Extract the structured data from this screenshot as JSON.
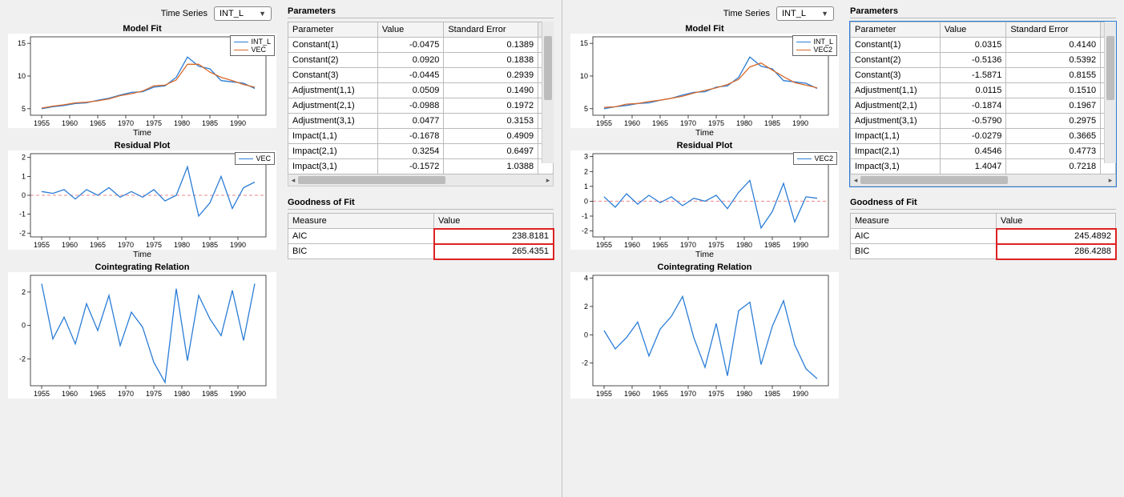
{
  "panels": [
    {
      "time_series_label": "Time Series",
      "time_series_value": "INT_L",
      "parameters_label": "Parameters",
      "param_headers": [
        "Parameter",
        "Value",
        "Standard Error"
      ],
      "param_rows": [
        {
          "p": "Constant(1)",
          "v": "-0.0475",
          "se": "0.1389"
        },
        {
          "p": "Constant(2)",
          "v": "0.0920",
          "se": "0.1838"
        },
        {
          "p": "Constant(3)",
          "v": "-0.0445",
          "se": "0.2939"
        },
        {
          "p": "Adjustment(1,1)",
          "v": "0.0509",
          "se": "0.1490"
        },
        {
          "p": "Adjustment(2,1)",
          "v": "-0.0988",
          "se": "0.1972"
        },
        {
          "p": "Adjustment(3,1)",
          "v": "0.0477",
          "se": "0.3153"
        },
        {
          "p": "Impact(1,1)",
          "v": "-0.1678",
          "se": "0.4909"
        },
        {
          "p": "Impact(2,1)",
          "v": "0.3254",
          "se": "0.6497"
        },
        {
          "p": "Impact(3,1)",
          "v": "-0.1572",
          "se": "1.0388"
        }
      ],
      "goodness_label": "Goodness of Fit",
      "fit_headers": [
        "Measure",
        "Value"
      ],
      "fit_rows": [
        {
          "m": "AIC",
          "v": "238.8181"
        },
        {
          "m": "BIC",
          "v": "265.4351"
        }
      ],
      "charts": {
        "model_fit": {
          "title": "Model Fit",
          "xlabel": "Time",
          "legend": [
            "INT_L",
            "VEC"
          ],
          "legend_colors": [
            "#2b7dd6",
            "#d76a2b"
          ]
        },
        "residual": {
          "title": "Residual Plot",
          "xlabel": "Time",
          "legend": [
            "VEC"
          ],
          "legend_colors": [
            "#2b7dd6"
          ]
        },
        "coint": {
          "title": "Cointegrating Relation",
          "xlabel": ""
        }
      }
    },
    {
      "time_series_label": "Time Series",
      "time_series_value": "INT_L",
      "parameters_label": "Parameters",
      "param_headers": [
        "Parameter",
        "Value",
        "Standard Error"
      ],
      "param_rows": [
        {
          "p": "Constant(1)",
          "v": "0.0315",
          "se": "0.4140"
        },
        {
          "p": "Constant(2)",
          "v": "-0.5136",
          "se": "0.5392"
        },
        {
          "p": "Constant(3)",
          "v": "-1.5871",
          "se": "0.8155"
        },
        {
          "p": "Adjustment(1,1)",
          "v": "0.0115",
          "se": "0.1510"
        },
        {
          "p": "Adjustment(2,1)",
          "v": "-0.1874",
          "se": "0.1967"
        },
        {
          "p": "Adjustment(3,1)",
          "v": "-0.5790",
          "se": "0.2975"
        },
        {
          "p": "Impact(1,1)",
          "v": "-0.0279",
          "se": "0.3665"
        },
        {
          "p": "Impact(2,1)",
          "v": "0.4546",
          "se": "0.4773"
        },
        {
          "p": "Impact(3,1)",
          "v": "1.4047",
          "se": "0.7218"
        }
      ],
      "goodness_label": "Goodness of Fit",
      "fit_headers": [
        "Measure",
        "Value"
      ],
      "fit_rows": [
        {
          "m": "AIC",
          "v": "245.4892"
        },
        {
          "m": "BIC",
          "v": "286.4288"
        }
      ],
      "charts": {
        "model_fit": {
          "title": "Model Fit",
          "xlabel": "Time",
          "legend": [
            "INT_L",
            "VEC2"
          ],
          "legend_colors": [
            "#2b7dd6",
            "#d76a2b"
          ]
        },
        "residual": {
          "title": "Residual Plot",
          "xlabel": "Time",
          "legend": [
            "VEC2"
          ],
          "legend_colors": [
            "#2b7dd6"
          ]
        },
        "coint": {
          "title": "Cointegrating Relation",
          "xlabel": ""
        }
      }
    }
  ],
  "chart_data": [
    {
      "panel": 0,
      "model_fit": {
        "type": "line",
        "x": [
          1955,
          1957,
          1959,
          1961,
          1963,
          1965,
          1967,
          1969,
          1971,
          1973,
          1975,
          1977,
          1979,
          1981,
          1983,
          1985,
          1987,
          1989,
          1991,
          1993
        ],
        "series": [
          {
            "name": "INT_L",
            "values": [
              5.0,
              5.3,
              5.5,
              5.8,
              5.9,
              6.3,
              6.6,
              7.1,
              7.5,
              7.6,
              8.3,
              8.5,
              9.8,
              12.9,
              11.5,
              11.1,
              9.3,
              9.1,
              8.9,
              8.1
            ]
          },
          {
            "name": "VEC",
            "values": [
              5.1,
              5.4,
              5.6,
              5.9,
              6.0,
              6.2,
              6.5,
              7.0,
              7.3,
              7.7,
              8.5,
              8.6,
              9.4,
              11.8,
              11.8,
              10.6,
              9.8,
              9.3,
              8.7,
              8.3
            ]
          }
        ],
        "ylim": [
          4,
          16
        ],
        "yticks": [
          5,
          10,
          15
        ],
        "xlim": [
          1953,
          1995
        ],
        "xticks": [
          1955,
          1960,
          1965,
          1970,
          1975,
          1980,
          1985,
          1990
        ],
        "xlabel": "Time",
        "title": "Model Fit"
      },
      "residual": {
        "type": "line",
        "x": [
          1955,
          1957,
          1959,
          1961,
          1963,
          1965,
          1967,
          1969,
          1971,
          1973,
          1975,
          1977,
          1979,
          1981,
          1983,
          1985,
          1987,
          1989,
          1991,
          1993
        ],
        "series": [
          {
            "name": "VEC",
            "values": [
              0.2,
              0.1,
              0.3,
              -0.2,
              0.3,
              0.0,
              0.4,
              -0.1,
              0.2,
              -0.1,
              0.3,
              -0.3,
              0.0,
              1.5,
              -1.1,
              -0.4,
              1.0,
              -0.7,
              0.4,
              0.7
            ]
          }
        ],
        "ylim": [
          -2.2,
          2.2
        ],
        "yticks": [
          -2,
          -1,
          0,
          1,
          2
        ],
        "xlim": [
          1953,
          1995
        ],
        "xticks": [
          1955,
          1960,
          1965,
          1970,
          1975,
          1980,
          1985,
          1990
        ],
        "xlabel": "Time",
        "title": "Residual Plot",
        "zero_line": true
      },
      "coint": {
        "type": "line",
        "x": [
          1955,
          1957,
          1959,
          1961,
          1963,
          1965,
          1967,
          1969,
          1971,
          1973,
          1975,
          1977,
          1979,
          1981,
          1983,
          1985,
          1987,
          1989,
          1991,
          1993
        ],
        "series": [
          {
            "name": "coint",
            "values": [
              2.5,
              -0.8,
              0.5,
              -1.1,
              1.3,
              -0.3,
              1.8,
              -1.2,
              0.8,
              -0.1,
              -2.2,
              -3.4,
              2.2,
              -2.1,
              1.8,
              0.4,
              -0.6,
              2.1,
              -0.9,
              2.5
            ]
          }
        ],
        "ylim": [
          -3.6,
          3.0
        ],
        "yticks": [
          -2,
          0,
          2
        ],
        "xlim": [
          1953,
          1995
        ],
        "xticks": [
          1955,
          1960,
          1965,
          1970,
          1975,
          1980,
          1985,
          1990
        ],
        "title": "Cointegrating Relation"
      }
    },
    {
      "panel": 1,
      "model_fit": {
        "type": "line",
        "x": [
          1955,
          1957,
          1959,
          1961,
          1963,
          1965,
          1967,
          1969,
          1971,
          1973,
          1975,
          1977,
          1979,
          1981,
          1983,
          1985,
          1987,
          1989,
          1991,
          1993
        ],
        "series": [
          {
            "name": "INT_L",
            "values": [
              5.0,
              5.3,
              5.5,
              5.8,
              5.9,
              6.3,
              6.6,
              7.1,
              7.5,
              7.6,
              8.3,
              8.5,
              9.8,
              12.9,
              11.5,
              11.1,
              9.3,
              9.1,
              8.9,
              8.1
            ]
          },
          {
            "name": "VEC2",
            "values": [
              5.2,
              5.3,
              5.7,
              5.8,
              6.1,
              6.3,
              6.6,
              6.9,
              7.4,
              7.8,
              8.2,
              8.7,
              9.5,
              11.4,
              12.0,
              10.9,
              9.9,
              9.0,
              8.6,
              8.2
            ]
          }
        ],
        "ylim": [
          4,
          16
        ],
        "yticks": [
          5,
          10,
          15
        ],
        "xlim": [
          1953,
          1995
        ],
        "xticks": [
          1955,
          1960,
          1965,
          1970,
          1975,
          1980,
          1985,
          1990
        ],
        "xlabel": "Time",
        "title": "Model Fit"
      },
      "residual": {
        "type": "line",
        "x": [
          1955,
          1957,
          1959,
          1961,
          1963,
          1965,
          1967,
          1969,
          1971,
          1973,
          1975,
          1977,
          1979,
          1981,
          1983,
          1985,
          1987,
          1989,
          1991,
          1993
        ],
        "series": [
          {
            "name": "VEC2",
            "values": [
              0.3,
              -0.4,
              0.5,
              -0.2,
              0.4,
              -0.1,
              0.3,
              -0.3,
              0.2,
              0.0,
              0.4,
              -0.5,
              0.6,
              1.4,
              -1.8,
              -0.7,
              1.2,
              -1.4,
              0.3,
              0.2
            ]
          }
        ],
        "ylim": [
          -2.4,
          3.2
        ],
        "yticks": [
          -2,
          -1,
          0,
          1,
          2,
          3
        ],
        "xlim": [
          1953,
          1995
        ],
        "xticks": [
          1955,
          1960,
          1965,
          1970,
          1975,
          1980,
          1985,
          1990
        ],
        "xlabel": "Time",
        "title": "Residual Plot",
        "zero_line": true
      },
      "coint": {
        "type": "line",
        "x": [
          1955,
          1957,
          1959,
          1961,
          1963,
          1965,
          1967,
          1969,
          1971,
          1973,
          1975,
          1977,
          1979,
          1981,
          1983,
          1985,
          1987,
          1989,
          1991,
          1993
        ],
        "series": [
          {
            "name": "coint",
            "values": [
              0.3,
              -1.0,
              -0.2,
              0.9,
              -1.5,
              0.4,
              1.3,
              2.7,
              -0.2,
              -2.3,
              0.8,
              -2.9,
              1.7,
              2.3,
              -2.1,
              0.6,
              2.4,
              -0.7,
              -2.4,
              -3.1
            ]
          }
        ],
        "ylim": [
          -3.6,
          4.2
        ],
        "yticks": [
          -2,
          0,
          2,
          4
        ],
        "xlim": [
          1953,
          1995
        ],
        "xticks": [
          1955,
          1960,
          1965,
          1970,
          1975,
          1980,
          1985,
          1990
        ],
        "title": "Cointegrating Relation"
      }
    }
  ]
}
